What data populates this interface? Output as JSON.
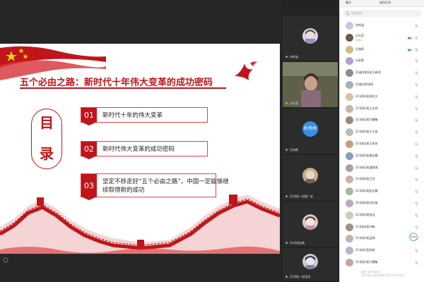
{
  "slide": {
    "title": "五个必由之路：新时代十年伟大变革的成功密码",
    "mulu_chars": [
      "目",
      "录"
    ],
    "items": [
      {
        "num": "01",
        "text": "新时代十年的伟大变革"
      },
      {
        "num": "02",
        "text": "新时代伟大变革的成功密码"
      },
      {
        "num": "03",
        "text": "坚定不移走好“五个必由之路”，中国一定能够继续取得新的成功"
      }
    ]
  },
  "tiles": [
    {
      "name": "何梓涵",
      "avatar_color": "#c8c8d8"
    },
    {
      "name": "吕丰武",
      "avatar_color": "#7a6a55"
    },
    {
      "name": "吕海燕",
      "text_avatar": "杜秀林"
    },
    {
      "name": "吕舒燕",
      "avatar_color": "#b8a88a"
    },
    {
      "name": "22学前一班陈广宏",
      "avatar_color": "#d0c0b0"
    },
    {
      "name": "22学前幼教",
      "avatar_color": "#c7b3b3"
    },
    {
      "name": "22学前一班张涛",
      "avatar_color": "#b0b0b0"
    }
  ],
  "panel": {
    "tabs": [
      "聊天",
      "成员(19)"
    ],
    "search_placeholder": "搜索成员",
    "members": [
      {
        "name": "时梓涵",
        "sub": "",
        "avatar_color": "#c9c6de"
      },
      {
        "name": "吕丰武",
        "sub": "主持人",
        "avatar_color": "#6b5a45"
      },
      {
        "name": "吕海燕",
        "sub": "",
        "avatar_color": "#d6b98a"
      },
      {
        "name": "吕舒燕",
        "sub": "",
        "avatar_color": "#b7a0c8"
      },
      {
        "name": "21级学前2班王新然",
        "sub": "",
        "avatar_color": "#8c8c8c"
      },
      {
        "name": "21级学前张研",
        "sub": "",
        "avatar_color": "#a0b0c0"
      },
      {
        "name": "21学前2班邢文文",
        "sub": "",
        "avatar_color": "#d8c2a8"
      },
      {
        "name": "21学前2班王志伟",
        "sub": "",
        "avatar_color": "#c4b4a4"
      },
      {
        "name": "21学前2班马慧敏",
        "sub": "",
        "avatar_color": "#998877"
      },
      {
        "name": "21学前2班王五雨",
        "sub": "",
        "avatar_color": "#bbbbbb"
      },
      {
        "name": "21学前2班王雨辛",
        "sub": "",
        "avatar_color": "#c0a080"
      },
      {
        "name": "21学前2班谢佳慧",
        "sub": "",
        "avatar_color": "#8aa0b8"
      },
      {
        "name": "21学前2班潘琪琪",
        "sub": "",
        "avatar_color": "#b0a0a0"
      },
      {
        "name": "21学前2班王欣",
        "sub": "",
        "avatar_color": "#c9b0a0"
      },
      {
        "name": "21学前2班赵文静",
        "sub": "",
        "avatar_color": "#a8b8a0"
      },
      {
        "name": "21学前2班刘红丽",
        "sub": "",
        "avatar_color": "#b8a8c0"
      },
      {
        "name": "21学前2班张佳",
        "sub": "",
        "avatar_color": "#d0c8b8"
      },
      {
        "name": "21学前2班刘婷",
        "sub": "",
        "avatar_color": "#a09080"
      },
      {
        "name": "21学前2班孟婷",
        "sub": "",
        "avatar_color": "#c8b0b0"
      },
      {
        "name": "21学前2班李超",
        "sub": "",
        "avatar_color": "#b0b8c8"
      },
      {
        "name": "21学前2班马慧敏",
        "sub": "",
        "avatar_color": "#c0a8a0"
      }
    ],
    "speed": "53%",
    "watermark_line1": "激活 Windows",
    "watermark_line2": "22学前二班刘雨彤21821420526"
  }
}
